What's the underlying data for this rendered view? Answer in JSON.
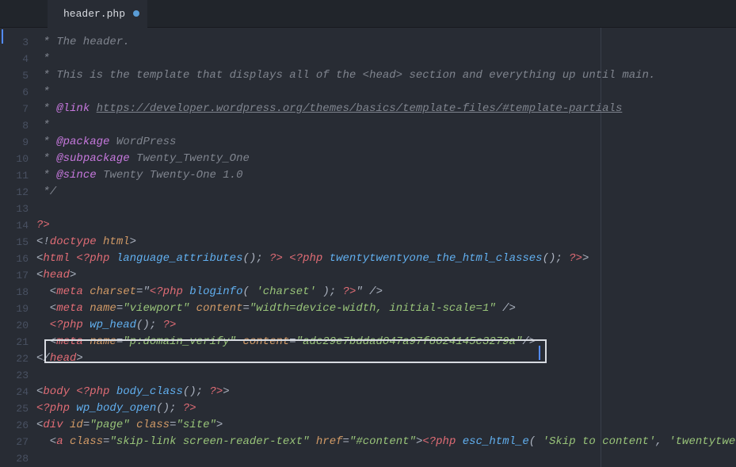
{
  "tab": {
    "filename": "header.php",
    "modified": true
  },
  "gutter": {
    "start": 3,
    "end": 28
  },
  "lines": {
    "l3": " * The header.",
    "l4": " *",
    "l5": " * This is the template that displays all of the <head> section and everything up until main.",
    "l6": " *",
    "l7_prefix": " * ",
    "l7_tag": "@link",
    "l7_link": "https://developer.wordpress.org/themes/basics/template-files/#template-partials",
    "l8": " *",
    "l9_prefix": " * ",
    "l9_tag": "@package",
    "l9_val": " WordPress",
    "l10_prefix": " * ",
    "l10_tag": "@subpackage",
    "l10_val": " Twenty_Twenty_One",
    "l11_prefix": " * ",
    "l11_tag": "@since",
    "l11_val": " Twenty Twenty-One 1.0",
    "l12": " */",
    "l13": "",
    "l14": "?>",
    "l15_open": "<!",
    "l15_tag": "doctype",
    "l15_attr": " html",
    "l15_close": ">",
    "l16_open": "<",
    "l16_tag": "html",
    "l16_php1_open": " <?php",
    "l16_func1": " language_attributes",
    "l16_paren1": "();",
    "l16_php1_close": " ?>",
    "l16_php2_open": " <?php",
    "l16_func2": " twentytwentyone_the_html_classes",
    "l16_paren2": "();",
    "l16_php2_close": " ?>",
    "l16_close": ">",
    "l17_open": "<",
    "l17_tag": "head",
    "l17_close": ">",
    "l18_open": "  <",
    "l18_tag": "meta",
    "l18_attr": " charset",
    "l18_eq": "=\"",
    "l18_php_open": "<?php",
    "l18_func": " bloginfo",
    "l18_paren_open": "( ",
    "l18_str": "'charset'",
    "l18_paren_close": " );",
    "l18_php_close": " ?>",
    "l18_close": "\" />",
    "l19_open": "  <",
    "l19_tag": "meta",
    "l19_attr1": " name",
    "l19_eq1": "=",
    "l19_str1": "\"viewport\"",
    "l19_attr2": " content",
    "l19_eq2": "=",
    "l19_str2": "\"width=device-width, initial-scale=1\"",
    "l19_close": " />",
    "l20_open": "  <?php",
    "l20_func": " wp_head",
    "l20_paren": "();",
    "l20_close": " ?>",
    "l21_open": "  <",
    "l21_tag": "meta",
    "l21_attr1": " name",
    "l21_eq1": "=",
    "l21_str1": "\"p:domain_verify\"",
    "l21_attr2": " content",
    "l21_eq2": "=",
    "l21_str2": "\"adc29e7bddad047a97f8024145c3279a\"",
    "l21_close": "/>",
    "l22_open": "</",
    "l22_tag": "head",
    "l22_close": ">",
    "l23": "",
    "l24_open": "<",
    "l24_tag": "body",
    "l24_php_open": " <?php",
    "l24_func": " body_class",
    "l24_paren": "();",
    "l24_php_close": " ?>",
    "l24_close": ">",
    "l25_open": "<?php",
    "l25_func": " wp_body_open",
    "l25_paren": "();",
    "l25_close": " ?>",
    "l26_open": "<",
    "l26_tag": "div",
    "l26_attr1": " id",
    "l26_eq1": "=",
    "l26_str1": "\"page\"",
    "l26_attr2": " class",
    "l26_eq2": "=",
    "l26_str2": "\"site\"",
    "l26_close": ">",
    "l27_open": "  <",
    "l27_tag": "a",
    "l27_attr1": " class",
    "l27_eq1": "=",
    "l27_str1": "\"skip-link screen-reader-text\"",
    "l27_attr2": " href",
    "l27_eq2": "=",
    "l27_str2": "\"#content\"",
    "l27_close": ">",
    "l27_php_open": "<?php",
    "l27_func": " esc_html_e",
    "l27_paren_open": "( ",
    "l27_strarg1": "'Skip to content'",
    "l27_comma": ", ",
    "l27_strarg2": "'twentytwe"
  }
}
